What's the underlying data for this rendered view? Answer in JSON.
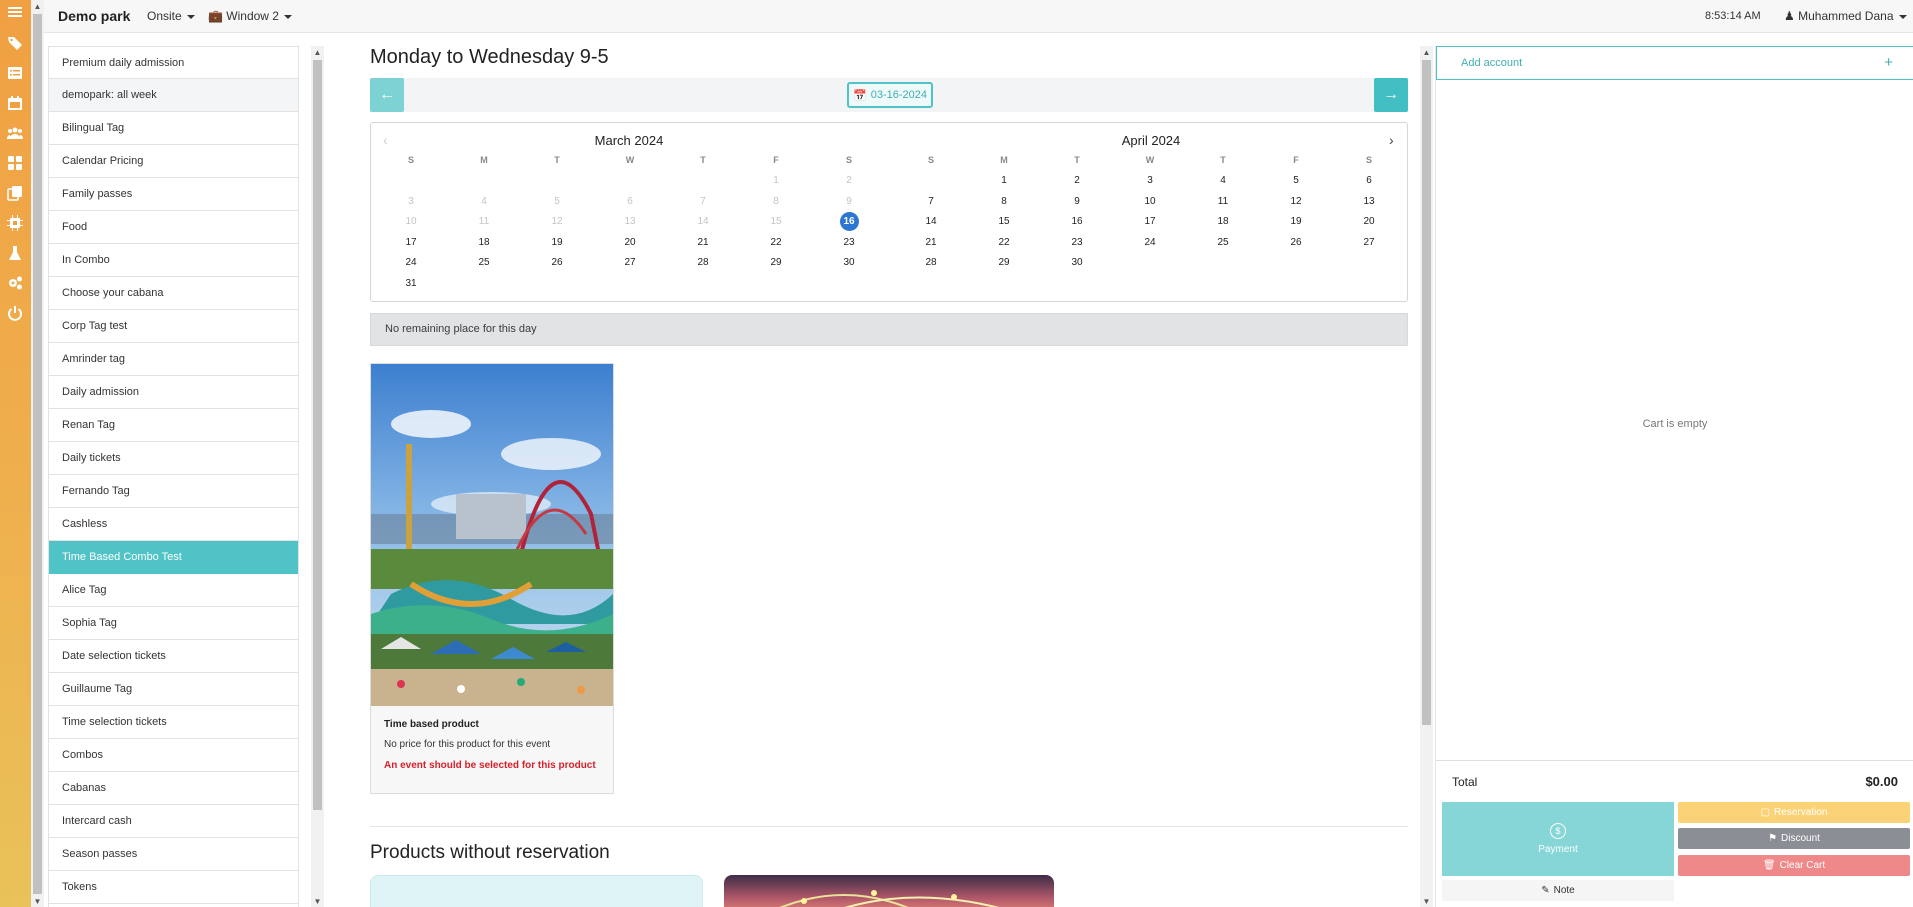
{
  "topbar": {
    "brand": "Demo park",
    "mode": "Onsite",
    "window": "Window 2",
    "time": "8:53:14 AM",
    "user": "Muhammed Dana"
  },
  "rail_icons": [
    "menu-icon",
    "tags-icon",
    "list-icon",
    "calendar-icon",
    "users-icon",
    "grid-icon",
    "copy-icon",
    "chip-icon",
    "flask-icon",
    "cogs-icon",
    "power-icon"
  ],
  "categories": [
    {
      "label": "Premium daily admission"
    },
    {
      "label": "demopark: all week"
    },
    {
      "label": "Bilingual Tag"
    },
    {
      "label": "Calendar Pricing"
    },
    {
      "label": "Family passes"
    },
    {
      "label": "Food"
    },
    {
      "label": "In Combo"
    },
    {
      "label": "Choose your cabana"
    },
    {
      "label": "Corp Tag test"
    },
    {
      "label": "Amrinder tag"
    },
    {
      "label": "Daily admission"
    },
    {
      "label": "Renan Tag"
    },
    {
      "label": "Daily tickets"
    },
    {
      "label": "Fernando Tag"
    },
    {
      "label": "Cashless"
    },
    {
      "label": "Time Based Combo Test"
    },
    {
      "label": "Alice Tag"
    },
    {
      "label": "Sophia Tag"
    },
    {
      "label": "Date selection tickets"
    },
    {
      "label": "Guillaume Tag"
    },
    {
      "label": "Time selection tickets"
    },
    {
      "label": "Combos"
    },
    {
      "label": "Cabanas"
    },
    {
      "label": "Intercard cash"
    },
    {
      "label": "Season passes"
    },
    {
      "label": "Tokens"
    }
  ],
  "active_category": "Time Based Combo Test",
  "main": {
    "title": "Monday to Wednesday 9-5",
    "date": "03-16-2024",
    "alert": "No remaining place for this day",
    "product": {
      "name": "Time based product",
      "price_note": "No price for this product for this event",
      "warning": "An event should be selected for this product"
    },
    "section_title": "Products without reservation"
  },
  "calendar": {
    "weekdays": [
      "S",
      "M",
      "T",
      "W",
      "T",
      "F",
      "S"
    ],
    "selected_day": "16",
    "months": [
      {
        "title": "March 2024",
        "weeks": [
          [
            "",
            "",
            "",
            "",
            "",
            "1",
            "2"
          ],
          [
            "3",
            "4",
            "5",
            "6",
            "7",
            "8",
            "9"
          ],
          [
            "10",
            "11",
            "12",
            "13",
            "14",
            "15",
            "16"
          ],
          [
            "17",
            "18",
            "19",
            "20",
            "21",
            "22",
            "23"
          ],
          [
            "24",
            "25",
            "26",
            "27",
            "28",
            "29",
            "30"
          ],
          [
            "31",
            "",
            "",
            "",
            "",
            "",
            ""
          ]
        ],
        "disabled_until_index": 15
      },
      {
        "title": "April 2024",
        "weeks": [
          [
            "",
            "1",
            "2",
            "3",
            "4",
            "5",
            "6"
          ],
          [
            "7",
            "8",
            "9",
            "10",
            "11",
            "12",
            "13"
          ],
          [
            "14",
            "15",
            "16",
            "17",
            "18",
            "19",
            "20"
          ],
          [
            "21",
            "22",
            "23",
            "24",
            "25",
            "26",
            "27"
          ],
          [
            "28",
            "29",
            "30",
            "",
            "",
            "",
            ""
          ]
        ],
        "disabled_until_index": 0
      }
    ]
  },
  "cart": {
    "add_account": "Add account",
    "plus": "+",
    "empty": "Cart is empty",
    "total_label": "Total",
    "total_value": "$0.00",
    "payment": "Payment",
    "coin": "$",
    "reservation": "Reservation",
    "discount": "Discount",
    "clear": "Clear Cart",
    "note": "Note"
  }
}
